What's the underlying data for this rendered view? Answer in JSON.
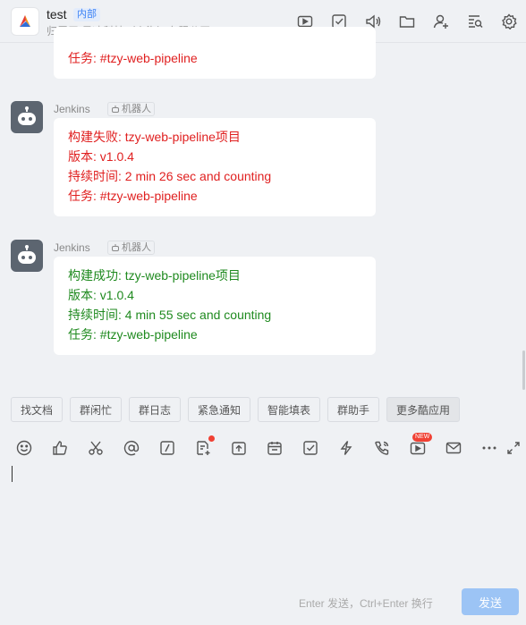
{
  "header": {
    "title": "test",
    "badge": "内部",
    "subtitle": "归属于 曼冰科技（上海）有限公司",
    "tools": [
      "video-icon",
      "task-check-icon",
      "announce-icon",
      "folder-icon",
      "add-member-icon",
      "search-list-icon",
      "settings-gear-icon"
    ]
  },
  "messages": [
    {
      "lines": [
        "任务: #tzy-web-pipeline"
      ]
    },
    {
      "sender": "Jenkins",
      "tag": "机器人",
      "status": "fail",
      "lines": [
        "构建失败: tzy-web-pipeline项目",
        "版本: v1.0.4",
        "持续时间: 2 min 26 sec and counting",
        "任务: #tzy-web-pipeline"
      ]
    },
    {
      "sender": "Jenkins",
      "tag": "机器人",
      "status": "success",
      "lines": [
        "构建成功: tzy-web-pipeline项目",
        "版本: v1.0.4",
        "持续时间: 4 min 55 sec and counting",
        "任务: #tzy-web-pipeline"
      ]
    }
  ],
  "quick_apps": [
    "找文档",
    "群闲忙",
    "群日志",
    "紧急通知",
    "智能填表",
    "群助手",
    "更多酷应用"
  ],
  "toolbar": {
    "icons": [
      "emoji-icon",
      "thumbs-up-icon",
      "scissors-icon",
      "mention-icon",
      "slash-command-icon",
      "doc-add-icon",
      "upload-icon",
      "calendar-icon",
      "todo-check-icon",
      "lightning-icon",
      "phone-call-icon",
      "live-video-icon",
      "mail-icon",
      "more-icon",
      "expand-icon"
    ],
    "new_tag": "NEW"
  },
  "composer": {
    "hint": "Enter 发送，Ctrl+Enter 换行",
    "send_label": "发送"
  },
  "colors": {
    "fail": "#e02020",
    "success": "#1f8a1f",
    "accent": "#3b82f6"
  }
}
